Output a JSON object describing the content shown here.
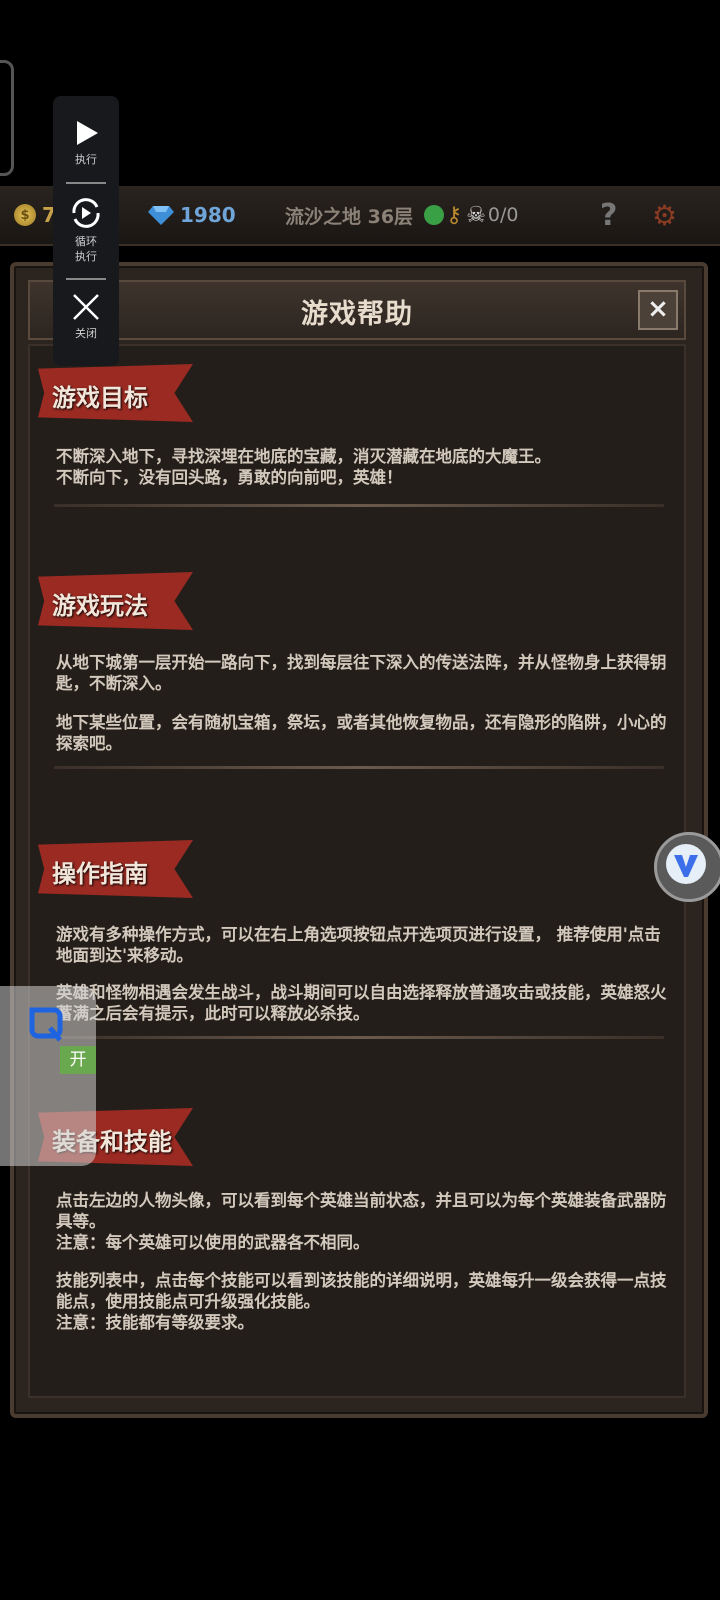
{
  "status_bar": {
    "gold": "7",
    "gems": "1980",
    "floor": "流沙之地 36层",
    "kills": "0/0",
    "help": "?"
  },
  "dialog": {
    "title": "游戏帮助",
    "close": "×",
    "sections": [
      {
        "title": "游戏目标",
        "paragraphs": [
          "不断深入地下，寻找深埋在地底的宝藏，消灭潜藏在地底的大魔王。\n不断向下，没有回头路，勇敢的向前吧，英雄！"
        ]
      },
      {
        "title": "游戏玩法",
        "paragraphs": [
          "从地下城第一层开始一路向下，找到每层往下深入的传送法阵，并从怪物身上获得钥匙，不断深入。",
          "地下某些位置，会有随机宝箱，祭坛，或者其他恢复物品，还有隐形的陷阱，小心的探索吧。"
        ]
      },
      {
        "title": "操作指南",
        "paragraphs": [
          "游戏有多种操作方式，可以在右上角选项按钮点开选项页进行设置，  推荐使用'点击地面到达'来移动。",
          "英雄和怪物相遇会发生战斗，战斗期间可以自由选择释放普通攻击或技能，英雄怒火蓄满之后会有提示，此时可以释放必杀技。"
        ]
      },
      {
        "title": "装备和技能",
        "paragraphs": [
          "点击左边的人物头像，可以看到每个英雄当前状态，并且可以为每个英雄装备武器防具等。\n注意：每个英雄可以使用的武器各不相同。",
          "技能列表中，点击每个技能可以看到该技能的详细说明，英雄每升一级会获得一点技能点，使用技能点可升级强化技能。\n注意：技能都有等级要求。"
        ]
      }
    ]
  },
  "float_toolbar": {
    "run": "执行",
    "loop_line1": "循环",
    "loop_line2": "执行",
    "close": "关闭"
  },
  "side_panel": {
    "open": "开"
  },
  "colors": {
    "ribbon": "#9a2a22",
    "background": "#241e1a",
    "text": "#d2c8bc"
  }
}
